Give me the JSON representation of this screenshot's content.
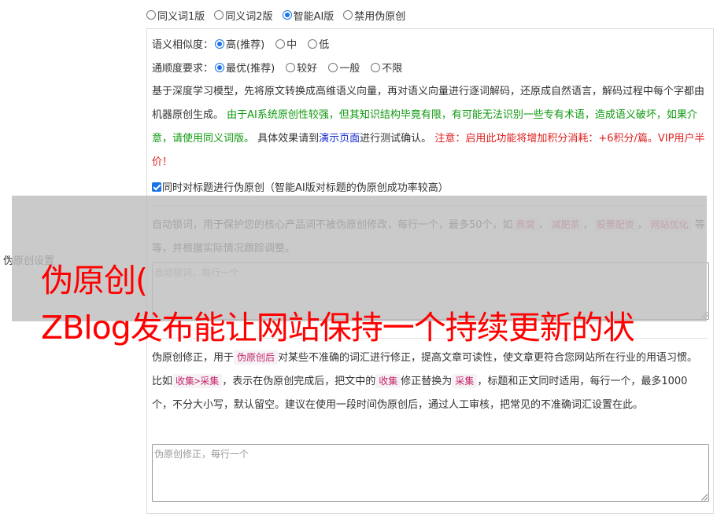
{
  "left_label": "伪原创设置",
  "version_options": [
    {
      "label": "同义词1版",
      "checked": false
    },
    {
      "label": "同义词2版",
      "checked": false
    },
    {
      "label": "智能AI版",
      "checked": true
    },
    {
      "label": "禁用伪原创",
      "checked": false
    }
  ],
  "similarity": {
    "label": "语义相似度：",
    "options": [
      {
        "label": "高(推荐)",
        "checked": true
      },
      {
        "label": "中",
        "checked": false
      },
      {
        "label": "低",
        "checked": false
      }
    ]
  },
  "fluency": {
    "label": "通顺度要求：",
    "options": [
      {
        "label": "最优(推荐)",
        "checked": true
      },
      {
        "label": "较好",
        "checked": false
      },
      {
        "label": "一般",
        "checked": false
      },
      {
        "label": "不限",
        "checked": false
      }
    ]
  },
  "description": {
    "part1": "基于深度学习模型，先将原文转换成高维语义向量，再对语义向量进行逐词解码，还原成自然语言，解码过程中每个字都由机器原创生成。 ",
    "part2_green": "由于AI系统原创性较强，但其知识结构毕竟有限，有可能无法识别一些专有术语，造成语义破坏，如果介意，请使用同义词版。",
    "part3": " 具体效果请到",
    "demo_link": "演示页面",
    "part4": "进行测试确认。 ",
    "part5_red": "注意：启用此功能将增加积分消耗：+6积分/篇。VIP用户半价！"
  },
  "title_checkbox": {
    "label": "同时对标题进行伪原创（智能AI版对标题的伪原创成功率较高）",
    "checked": true
  },
  "lock_words": {
    "desc_prefix": "自动锁词，用于保护您的核心产品词不被伪原创修改，每行一个，最多50个，如",
    "examples": [
      "燕窝",
      "减肥茶",
      "股票配资",
      "网站优化"
    ],
    "separator": "，",
    "desc_suffix": "等等，并根据实际情况跟踪调整。",
    "placeholder": "自动锁词，每行一个"
  },
  "correction": {
    "desc_a": "伪原创修正，用于",
    "code1": "伪原创后",
    "desc_b": "对某些不准确的词汇进行修正，提高文章可读性，使文章更符合您网站所在行业的用语习惯。比如",
    "code2": "收集>采集",
    "desc_c": "，表示在伪原创完成后，把文中的",
    "code3": "收集",
    "desc_d": "修正替换为",
    "code4": "采集",
    "desc_e": "，标题和正文同时适用，每行一个，最多1000个，不分大小写，默认留空。建议在使用一段时间伪原创后，通过人工审核，把常见的不准确词汇设置在此。",
    "placeholder": "伪原创修正，每行一个"
  },
  "headline": {
    "line1": "伪原创(",
    "line2": "ZBlog发布能让网站保持一个持续更新的状"
  },
  "colors": {
    "accent": "#1a73e8",
    "green_text": "#119911",
    "red_text": "#e02020",
    "link": "#1a2fd0",
    "headline": "#ff0000",
    "code_text": "#c4256a"
  }
}
